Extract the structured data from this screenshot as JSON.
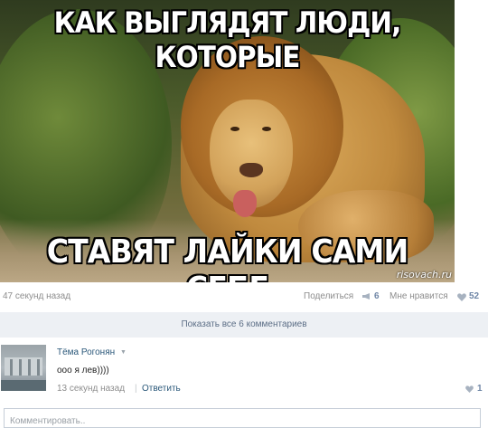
{
  "post": {
    "image": {
      "caption_top": "КАК ВЫГЛЯДЯТ ЛЮДИ, КОТОРЫЕ",
      "caption_bottom": "СТАВЯТ ЛАЙКИ САМИ СЕБЕ",
      "watermark": "risovach.ru"
    },
    "timestamp": "47 секунд назад",
    "share_label": "Поделиться",
    "share_count": "6",
    "like_label": "Мне нравится",
    "like_count": "52",
    "colors": {
      "count_blue": "#6f86a6",
      "link_blue": "#2b587a",
      "bar_bg": "#edf0f4"
    }
  },
  "comments_bar": {
    "label": "Показать все 6 комментариев"
  },
  "comment": {
    "author": "Тёма Рогонян",
    "text": "ооо я лев))))",
    "time": "13 секунд назад",
    "reply_label": "Ответить",
    "like_count": "1"
  },
  "reply_box": {
    "placeholder": "Комментировать.."
  },
  "icons": [
    "megaphone-icon",
    "heart-icon",
    "chevron-down-icon"
  ]
}
